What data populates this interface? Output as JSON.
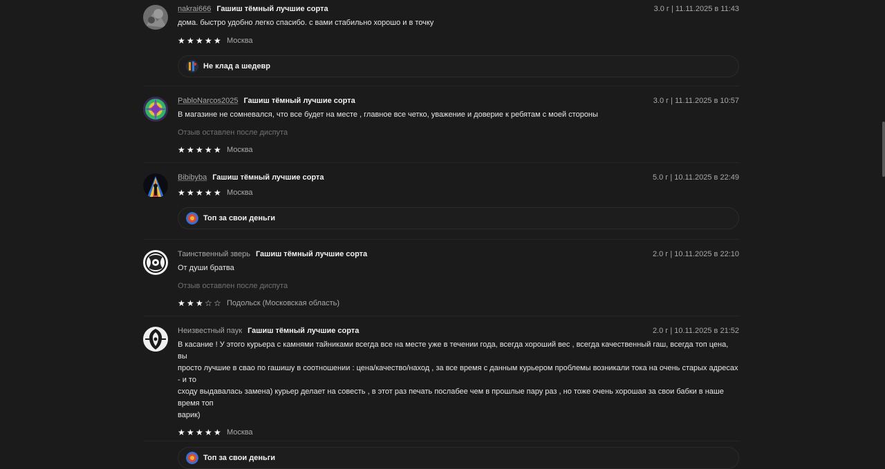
{
  "reviews": [
    {
      "user": "nakrai666",
      "product": "Гашиш тёмный лучшие сорта",
      "meta": "3.0 г | 11.11.2025 в 11:43",
      "text": "дома. быстро удобно легко спасибо. с вами стабильно хорошо и в точку",
      "rating": 5,
      "location": "Москва",
      "reply": "Не клад а шедевр"
    },
    {
      "user": "PabloNarcos2025",
      "product": "Гашиш тёмный лучшие сорта",
      "meta": "3.0 г | 11.11.2025 в 10:57",
      "text": "В магазине не сомневался, что все будет на месте , главное все четко, уважение и доверие к ребятам с моей стороны",
      "note": "Отзыв оставлен после диспута",
      "rating": 5,
      "location": "Москва"
    },
    {
      "user": "Bibibyba",
      "product": "Гашиш тёмный лучшие сорта",
      "meta": "5.0 г | 10.11.2025 в 22:49",
      "rating": 5,
      "location": "Москва",
      "reply": "Топ за свои деньги"
    },
    {
      "user": "Таинственный зверь",
      "product": "Гашиш тёмный лучшие сорта",
      "meta": "2.0 г | 10.11.2025 в 22:10",
      "text": "От души братва",
      "note": "Отзыв оставлен после диспута",
      "rating": 3,
      "location": "Подольск (Московская область)"
    },
    {
      "user": "Неизвестный паук",
      "product": "Гашиш тёмный лучшие сорта",
      "meta": "2.0 г | 10.11.2025 в 21:52",
      "text_lines": [
        "В касание ! У этого курьера с камнями тайниками всегда все на месте уже в течении года, всегда хороший вес , всегда качественный гаш, всегда топ цена, вы",
        "просто лучшие в свао по гашишу в соотношении : цена/качество/наход , за все время с данным курьером проблемы возникали тока на очень старых адресах - и то",
        "сходу выдавалась замена) курьер делает на совесть , в этот раз печать послабее чем в прошлые пару раз , но тоже очень хорошая за свои бабки в наше время топ",
        "варик)"
      ],
      "rating": 5,
      "location": "Москва",
      "reply": "Топ за свои деньги"
    }
  ],
  "icons": {
    "star_filled": "★",
    "star_empty": "☆"
  },
  "colors": {
    "background": "#1b1b1b",
    "text_primary": "#f2f2f2",
    "text_secondary": "#a9a9a9",
    "text_muted": "#727272"
  }
}
